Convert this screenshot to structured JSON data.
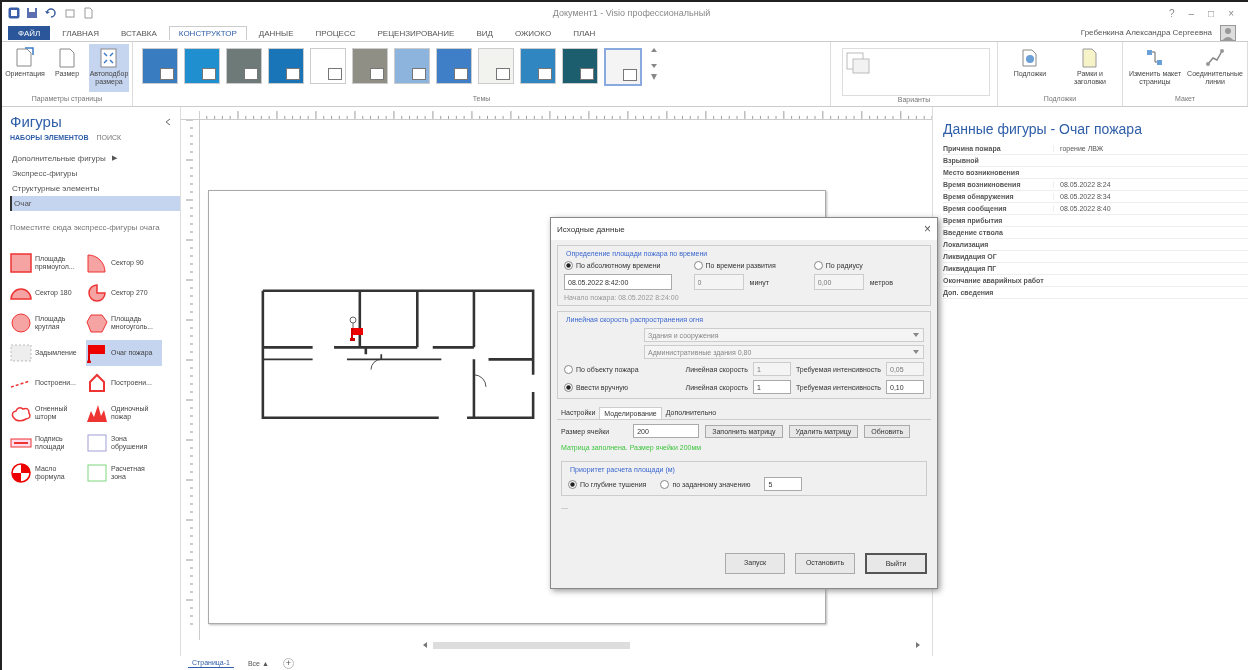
{
  "window": {
    "title": "Документ1 - Visio профессиональный",
    "controls": [
      "?",
      "–",
      "□",
      "×"
    ]
  },
  "ribbon_tabs": [
    {
      "label": "ФАЙЛ",
      "kind": "file",
      "selected": false
    },
    {
      "label": "ГЛАВНАЯ",
      "kind": "tab",
      "selected": false
    },
    {
      "label": "ВСТАВКА",
      "kind": "tab",
      "selected": false
    },
    {
      "label": "КОНСТРУКТОР",
      "kind": "tab",
      "selected": true
    },
    {
      "label": "ДАННЫЕ",
      "kind": "tab",
      "selected": false
    },
    {
      "label": "ПРОЦЕСС",
      "kind": "tab",
      "selected": false
    },
    {
      "label": "РЕЦЕНЗИРОВАНИЕ",
      "kind": "tab",
      "selected": false
    },
    {
      "label": "ВИД",
      "kind": "tab",
      "selected": false
    },
    {
      "label": "ОЖИОКО",
      "kind": "tab",
      "selected": false
    },
    {
      "label": "ПЛАН",
      "kind": "tab",
      "selected": false
    }
  ],
  "user": {
    "name": "Гребенкина Александра Сергеевна"
  },
  "ribbon_groups": [
    {
      "label": "Параметры страницы",
      "kind": "buttons",
      "buttons": [
        {
          "label": "Ориентация",
          "kind": "orientation",
          "selected": false
        },
        {
          "label": "Размер",
          "kind": "size",
          "selected": false
        },
        {
          "label": "Автоподбор размера",
          "kind": "autofit",
          "selected": true
        }
      ]
    },
    {
      "label": "Темы",
      "kind": "themes",
      "themes": [
        {
          "color": "#3a7cc0",
          "selected": false
        },
        {
          "color": "#1f8fd0",
          "selected": false
        },
        {
          "color": "#6e7a78",
          "selected": false
        },
        {
          "color": "#1a74b8",
          "selected": false
        },
        {
          "color": "#ffffff",
          "selected": false
        },
        {
          "color": "#8f8f86",
          "selected": false
        },
        {
          "color": "#8cb4dc",
          "selected": false
        },
        {
          "color": "#3f7fc8",
          "selected": false
        },
        {
          "color": "#f2f2ee",
          "selected": false
        },
        {
          "color": "#2f86c0",
          "selected": false
        },
        {
          "color": "#1d5e6e",
          "selected": false
        },
        {
          "color": "#f4f4f4",
          "selected": true
        }
      ]
    },
    {
      "label": "Варианты",
      "kind": "variants"
    },
    {
      "label": "Подложки",
      "kind": "buttons",
      "buttons": [
        {
          "label": "Подложки",
          "kind": "watermark",
          "selected": false
        },
        {
          "label": "Рамки и заголовки",
          "kind": "borders",
          "selected": false
        }
      ]
    },
    {
      "label": "Макет",
      "kind": "buttons",
      "buttons": [
        {
          "label": "Изменить макет страницы",
          "kind": "relayout",
          "selected": false
        },
        {
          "label": "Соединительные линии",
          "kind": "connectors",
          "selected": false
        }
      ]
    }
  ],
  "shapes_panel": {
    "title": "Фигуры",
    "tabs": [
      {
        "label": "НАБОРЫ ЭЛЕМЕНТОВ",
        "selected": true
      },
      {
        "label": "ПОИСК",
        "selected": false
      }
    ],
    "stencils": [
      {
        "label": "Дополнительные фигуры",
        "arrow": "▶",
        "selected": false
      },
      {
        "label": "Экспресс-фигуры",
        "selected": false
      },
      {
        "label": "Структурные элементы",
        "selected": false
      },
      {
        "label": "Очаг",
        "selected": true
      }
    ],
    "hint": "Поместите сюда экспресс-фигуры очага",
    "shapes": [
      {
        "label": "Площадь прямоугол...",
        "kind": "rect",
        "selected": false
      },
      {
        "label": "Сектор 90",
        "kind": "sector90",
        "selected": false
      },
      {
        "label": "Сектор 180",
        "kind": "sector180",
        "selected": false
      },
      {
        "label": "Сектор 270",
        "kind": "sector270",
        "selected": false
      },
      {
        "label": "Площадь круглая",
        "kind": "circle",
        "selected": false
      },
      {
        "label": "Площадь многоуголь...",
        "kind": "polygon",
        "selected": false
      },
      {
        "label": "Задымление",
        "kind": "smoke",
        "selected": false
      },
      {
        "label": "Очаг пожара",
        "kind": "flag",
        "selected": true
      },
      {
        "label": "Построени...",
        "kind": "line",
        "selected": false
      },
      {
        "label": "Построени...",
        "kind": "house",
        "selected": false
      },
      {
        "label": "Огненный шторм",
        "kind": "cloud",
        "selected": false
      },
      {
        "label": "Одиночный пожар",
        "kind": "fire",
        "selected": false
      },
      {
        "label": "Подпись площади",
        "kind": "label",
        "selected": false
      },
      {
        "label": "Зона обрушения",
        "kind": "zone",
        "selected": false
      },
      {
        "label": "Масло формула",
        "kind": "ball",
        "selected": false
      },
      {
        "label": "Расчетная зона",
        "kind": "calc",
        "selected": false
      }
    ]
  },
  "canvas": {
    "page_tabs": [
      {
        "label": "Страница-1",
        "selected": true
      },
      {
        "label": "Все ▲",
        "selected": false
      }
    ],
    "add_page": "+"
  },
  "shape_data": {
    "title": "Данные фигуры - Очаг пожара",
    "rows": [
      {
        "name": "Причина пожара",
        "value": "горение ЛВЖ"
      },
      {
        "name": "Взрывной"
      },
      {
        "name": "Место возникновения"
      },
      {
        "name": "Время возникновения",
        "value": "08.05.2022 8:24"
      },
      {
        "name": "Время обнаружения",
        "value": "08.05.2022 8:34"
      },
      {
        "name": "Время сообщения",
        "value": "08.05.2022 8:40"
      },
      {
        "name": "Время прибытия"
      },
      {
        "name": "Введение ствола"
      },
      {
        "name": "Локализация"
      },
      {
        "name": "Ликвидация ОГ"
      },
      {
        "name": "Ликвидация ПГ"
      },
      {
        "name": "Окончание аварийных работ"
      },
      {
        "name": "Доп. сведения"
      }
    ]
  },
  "dialog": {
    "title": "Исходные данные",
    "close": "×",
    "group_1": {
      "title": "Определение площади пожара по времени",
      "options": [
        {
          "label": "По абсолютному времени",
          "selected": true,
          "field": {
            "value": "08.05.2022 8:42:00",
            "disabled": false
          },
          "hint": "Начало пожара: 08.05.2022 8:24:00"
        },
        {
          "label": "По времени развития",
          "selected": false,
          "field": {
            "value": "0",
            "disabled": true
          },
          "unit": "минут"
        },
        {
          "label": "По радиусу",
          "selected": false,
          "field": {
            "value": "0,00",
            "disabled": true
          },
          "unit": "метров"
        }
      ]
    },
    "group_2": {
      "title": "Линейная скорость распространения огня",
      "options": [
        {
          "label": "По объекту пожара",
          "selected": false,
          "selects": [
            {
              "value": "Здания и сооружения",
              "disabled": true
            },
            {
              "value": "Административные здания 0,80",
              "disabled": true
            }
          ],
          "fields": [
            {
              "label": "Линейная скорость",
              "value": "1",
              "disabled": true
            },
            {
              "label": "Требуемая интенсивность",
              "value": "0,05",
              "disabled": true
            }
          ]
        },
        {
          "label": "Ввести вручную",
          "selected": true,
          "fields": [
            {
              "label": "Линейная скорость",
              "value": "1",
              "disabled": false
            },
            {
              "label": "Требуемая интенсивность",
              "value": "0,10",
              "disabled": false
            }
          ]
        }
      ]
    },
    "tabs": [
      {
        "label": "Настройки",
        "selected": false
      },
      {
        "label": "Моделирование",
        "selected": true
      },
      {
        "label": "Дополнительно",
        "selected": false
      }
    ],
    "cell_size": {
      "label": "Размер ячейки",
      "value": "200"
    },
    "buttons": [
      "Заполнить матрицу",
      "Удалить матрицу",
      "Обновить"
    ],
    "status": "Матрица заполнена. Размер ячейки 200мм",
    "group_3": {
      "title": "Приоритет расчета площади (м)",
      "options": [
        {
          "label": "По глубине тушения",
          "selected": true
        },
        {
          "label": "по заданному значению",
          "selected": false,
          "field": {
            "value": "5",
            "disabled": false
          }
        }
      ]
    },
    "note": "—",
    "footer_buttons": [
      {
        "label": "Запуск",
        "default": false
      },
      {
        "label": "Остановить",
        "default": false
      },
      {
        "label": "Выйти",
        "default": true
      }
    ]
  }
}
